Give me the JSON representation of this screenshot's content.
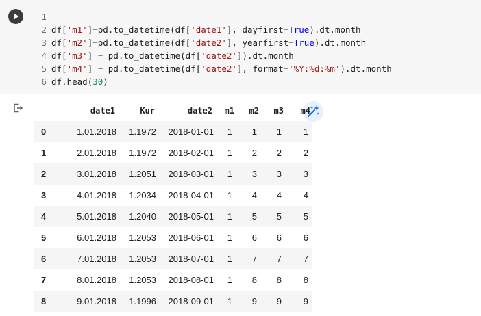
{
  "code_cell": {
    "line_numbers": [
      "1",
      "2",
      "3",
      "4",
      "5",
      "6"
    ],
    "lines": [
      [],
      [
        {
          "t": "df[",
          "c": ""
        },
        {
          "t": "'m1'",
          "c": "str"
        },
        {
          "t": "]=pd.to_datetime(df[",
          "c": ""
        },
        {
          "t": "'date1'",
          "c": "str"
        },
        {
          "t": "], dayfirst=",
          "c": ""
        },
        {
          "t": "True",
          "c": "kw"
        },
        {
          "t": ").dt.month",
          "c": ""
        }
      ],
      [
        {
          "t": "df[",
          "c": ""
        },
        {
          "t": "'m2'",
          "c": "str"
        },
        {
          "t": "]=pd.to_datetime(df[",
          "c": ""
        },
        {
          "t": "'date2'",
          "c": "str"
        },
        {
          "t": "], yearfirst=",
          "c": ""
        },
        {
          "t": "True",
          "c": "kw"
        },
        {
          "t": ").dt.month",
          "c": ""
        }
      ],
      [
        {
          "t": "df[",
          "c": ""
        },
        {
          "t": "'m3'",
          "c": "str"
        },
        {
          "t": "] = pd.to_datetime(df[",
          "c": ""
        },
        {
          "t": "'date2'",
          "c": "str"
        },
        {
          "t": "]).dt.month",
          "c": ""
        }
      ],
      [
        {
          "t": "df[",
          "c": ""
        },
        {
          "t": "'m4'",
          "c": "str"
        },
        {
          "t": "] = pd.to_datetime(df[",
          "c": ""
        },
        {
          "t": "'date2'",
          "c": "str"
        },
        {
          "t": "], format=",
          "c": ""
        },
        {
          "t": "'%Y:%d:%m'",
          "c": "str"
        },
        {
          "t": ").dt.month",
          "c": ""
        }
      ],
      [
        {
          "t": "df.head(",
          "c": ""
        },
        {
          "t": "30",
          "c": "num"
        },
        {
          "t": ")",
          "c": ""
        }
      ]
    ]
  },
  "icons": {
    "run": "play-circle-icon",
    "output": "output-arrow-icon",
    "magic": "magic-wand-sparkle-icon"
  },
  "colors": {
    "string": "#a31515",
    "keyword": "#0000ff",
    "number": "#098658",
    "magic_accent": "#1a73e8"
  },
  "table": {
    "columns": [
      "",
      "date1",
      "Kur",
      "date2",
      "m1",
      "m2",
      "m3",
      "m4"
    ],
    "rows": [
      [
        "0",
        "1.01.2018",
        "1.1972",
        "2018-01-01",
        "1",
        "1",
        "1",
        "1"
      ],
      [
        "1",
        "2.01.2018",
        "1.1972",
        "2018-02-01",
        "1",
        "2",
        "2",
        "2"
      ],
      [
        "2",
        "3.01.2018",
        "1.2051",
        "2018-03-01",
        "1",
        "3",
        "3",
        "3"
      ],
      [
        "3",
        "4.01.2018",
        "1.2034",
        "2018-04-01",
        "1",
        "4",
        "4",
        "4"
      ],
      [
        "4",
        "5.01.2018",
        "1.2040",
        "2018-05-01",
        "1",
        "5",
        "5",
        "5"
      ],
      [
        "5",
        "6.01.2018",
        "1.2053",
        "2018-06-01",
        "1",
        "6",
        "6",
        "6"
      ],
      [
        "6",
        "7.01.2018",
        "1.2053",
        "2018-07-01",
        "1",
        "7",
        "7",
        "7"
      ],
      [
        "7",
        "8.01.2018",
        "1.2053",
        "2018-08-01",
        "1",
        "8",
        "8",
        "8"
      ],
      [
        "8",
        "9.01.2018",
        "1.1996",
        "2018-09-01",
        "1",
        "9",
        "9",
        "9"
      ]
    ]
  }
}
